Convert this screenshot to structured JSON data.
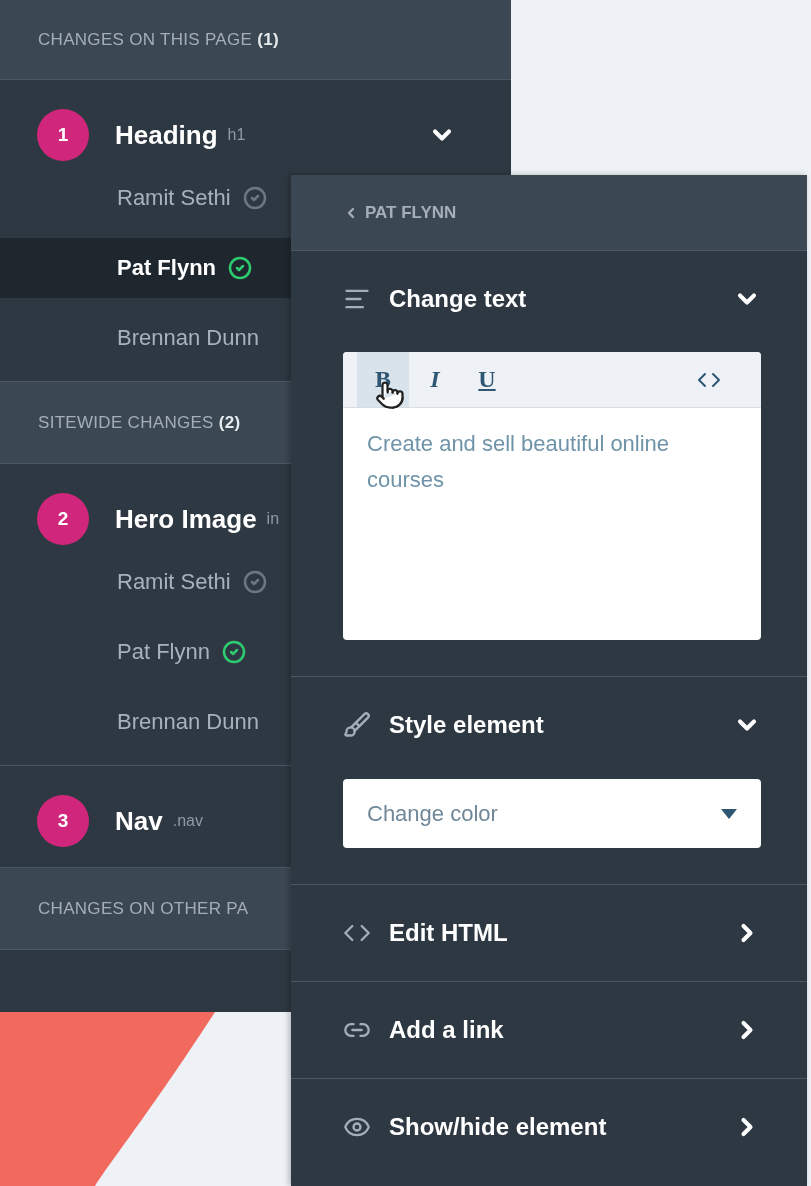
{
  "changes_panel": {
    "sections": [
      {
        "title": "CHANGES ON THIS PAGE **(1)**",
        "items": [
          {
            "number": "1",
            "name": "Heading",
            "tag": "h1",
            "expanded": true,
            "people": [
              {
                "name": "Ramit Sethi",
                "selected": false,
                "approved": false
              },
              {
                "name": "Pat Flynn",
                "selected": true,
                "approved": true
              },
              {
                "name": "Brennan Dunn",
                "selected": false
              }
            ]
          }
        ]
      },
      {
        "title": "SITEWIDE CHANGES **(2)**",
        "items": [
          {
            "number": "2",
            "name": "Hero Image",
            "tag": "in",
            "people": [
              {
                "name": "Ramit Sethi",
                "selected": false,
                "approved": false
              },
              {
                "name": "Pat Flynn",
                "selected": false,
                "approved": true
              },
              {
                "name": "Brennan Dunn",
                "selected": false
              }
            ]
          },
          {
            "number": "3",
            "name": "Nav",
            "tag": ".nav"
          }
        ]
      },
      {
        "title": "CHANGES ON OTHER PA"
      }
    ]
  },
  "detail_panel": {
    "back": "PAT FLYNN",
    "sections": [
      {
        "kind": "editor",
        "title": "Change text",
        "expanded": true,
        "toolbar": [
          {
            "label": "B",
            "selected": true
          },
          {
            "label": "I",
            "selected": false
          },
          {
            "label": "U",
            "selected": false
          }
        ],
        "text": "Create and sell beautiful online courses"
      },
      {
        "kind": "select",
        "title": "Style element",
        "expanded": true,
        "value": "Change color"
      },
      {
        "kind": "link",
        "title": "Edit HTML",
        "expanded": false
      },
      {
        "kind": "link",
        "title": "Add a link",
        "expanded": false
      },
      {
        "kind": "link",
        "title": "Show/hide element",
        "expanded": false
      }
    ]
  }
}
